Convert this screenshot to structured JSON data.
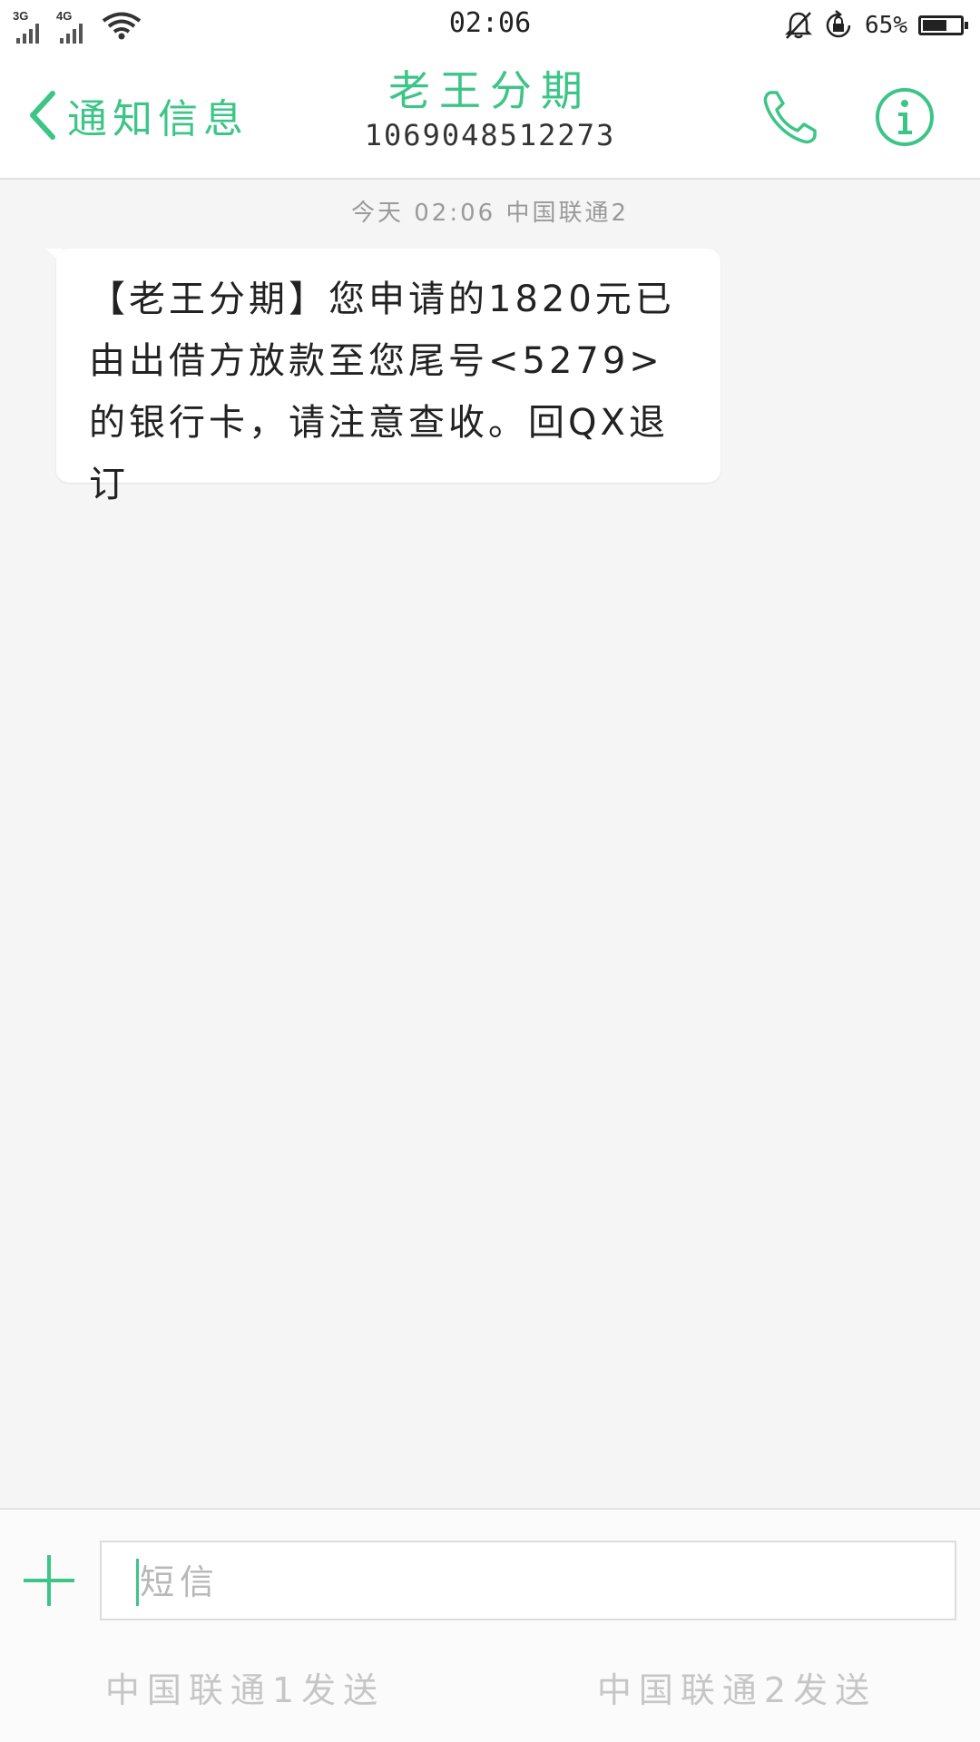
{
  "status_bar": {
    "sim1_network": "3G",
    "sim2_network": "4G",
    "time": "02:06",
    "battery_percent": "65%",
    "battery_level": 0.65,
    "icons": [
      "signal-icon",
      "wifi-icon",
      "mute-icon",
      "rotation-lock-icon",
      "battery-icon"
    ]
  },
  "header": {
    "back_label": "通知信息",
    "contact_name": "老王分期",
    "contact_number": "1069048512273",
    "accent_color": "#3cc587"
  },
  "conversation": {
    "timestamp": "今天 02:06  中国联通2",
    "messages": [
      {
        "direction": "incoming",
        "text": "【老王分期】您申请的1820元已由出借方放款至您尾号<5279>的银行卡，请注意查收。回QX退订"
      }
    ]
  },
  "composer": {
    "placeholder": "短信",
    "send_sim1_label": "中国联通1发送",
    "send_sim2_label": "中国联通2发送"
  }
}
